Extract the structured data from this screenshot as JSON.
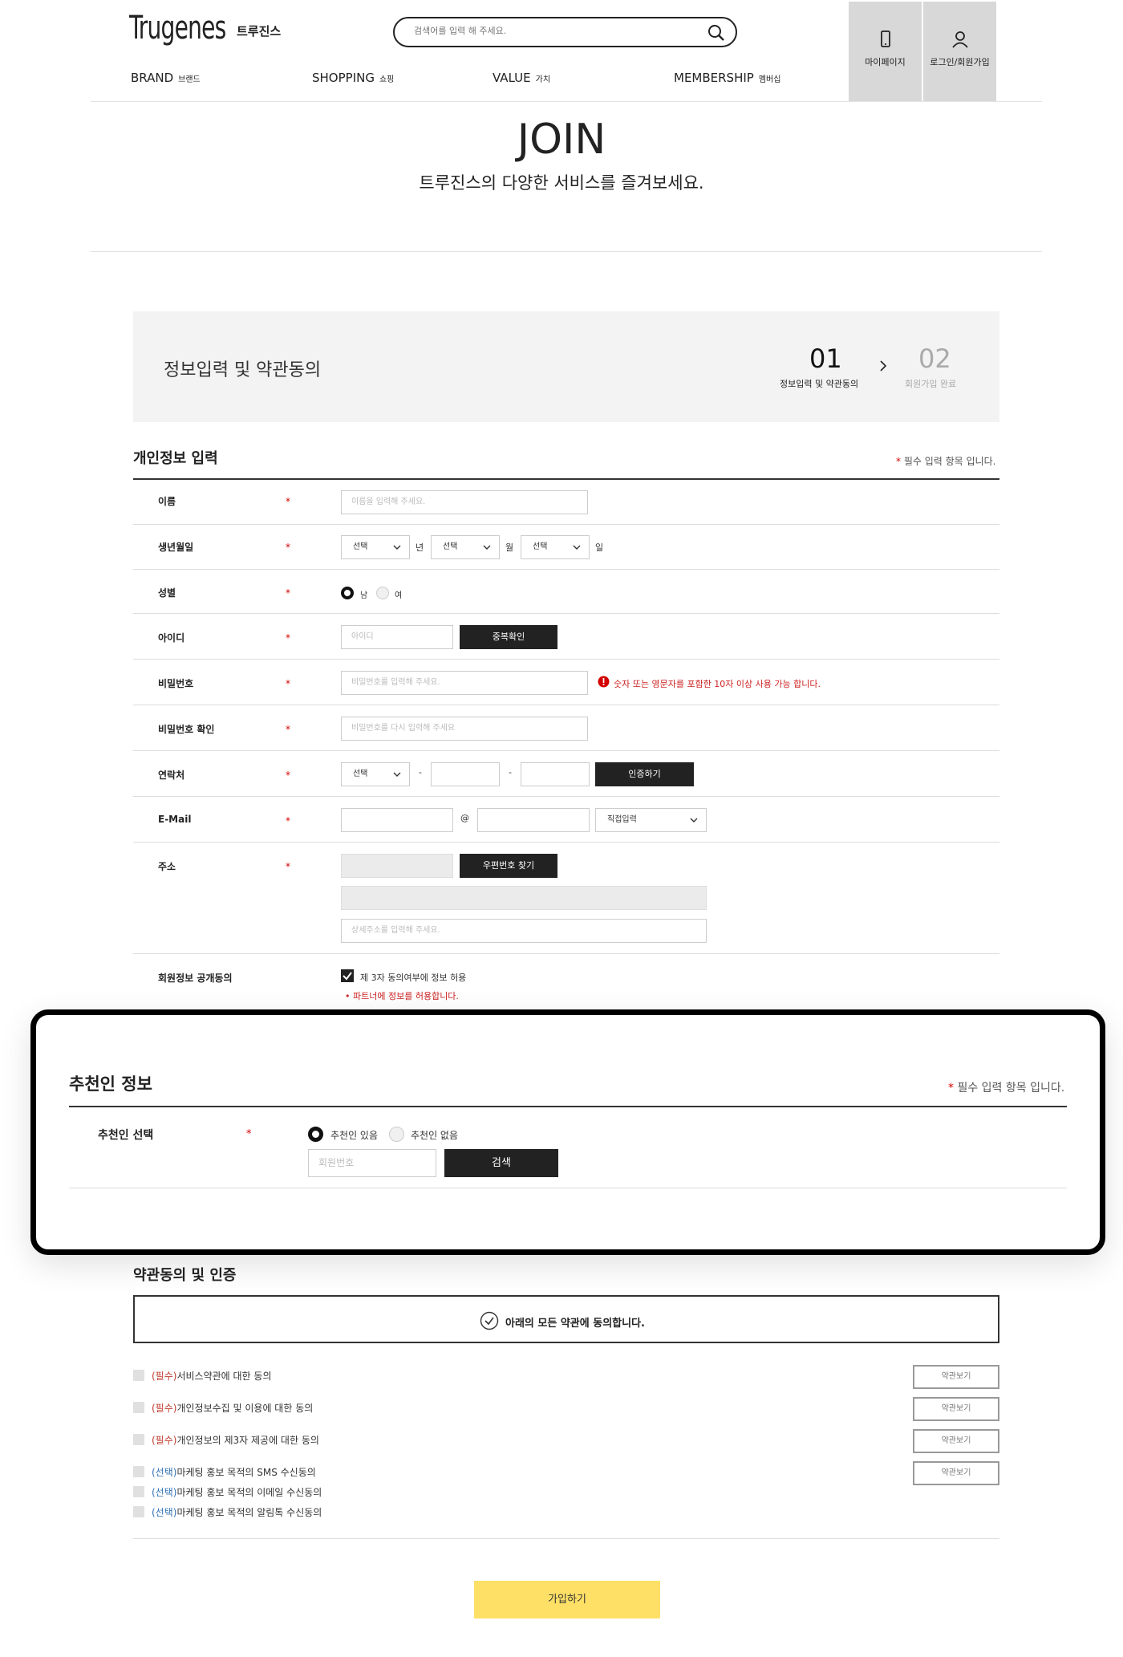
{
  "header": {
    "logo": "Trugenes",
    "logo_kr": "트루진스",
    "search_placeholder": "검색어를 입력 해 주세요.",
    "nav": [
      {
        "en": "BRAND",
        "kr": "브랜드"
      },
      {
        "en": "SHOPPING",
        "kr": "쇼핑"
      },
      {
        "en": "VALUE",
        "kr": "가치"
      },
      {
        "en": "MEMBERSHIP",
        "kr": "멤버십"
      }
    ],
    "mypage": "마이페이지",
    "login": "로그인/회원가입"
  },
  "hero": {
    "title": "JOIN",
    "subtitle": "트루진스의 다양한 서비스를 즐겨보세요."
  },
  "steps": {
    "title": "정보입력 및 약관동의",
    "step1_num": "01",
    "step1_label": "정보입력 및 약관동의",
    "step2_num": "02",
    "step2_label": "회원가입 완료"
  },
  "personal": {
    "title": "개인정보 입력",
    "required_note": "필수 입력 항목 입니다.",
    "star": "*",
    "name_label": "이름",
    "name_placeholder": "이름을 입력해 주세요.",
    "birth_label": "생년월일",
    "select": "선택",
    "year": "년",
    "month": "월",
    "day": "일",
    "gender_label": "성별",
    "male": "남",
    "female": "여",
    "id_label": "아이디",
    "id_placeholder": "아이디",
    "id_check": "중복확인",
    "pw_label": "비밀번호",
    "pw_placeholder": "비밀번호를 입력해 주세요.",
    "pw_warning": "숫자 또는 영문자를 포함한 10자 이상 사용 가능 합니다.",
    "pw2_label": "비밀번호 확인",
    "pw2_placeholder": "비밀번호를 다시 입력해 주세요",
    "phone_label": "연락처",
    "dash": "-",
    "verify": "인증하기",
    "email_label": "E-Mail",
    "at": "@",
    "direct_input": "직접입력",
    "address_label": "주소",
    "zip_button": "우편번호 찾기",
    "detail_placeholder": "상세주소를 입력해 주세요.",
    "disclose_label": "회원정보 공개동의",
    "disclose_text": "제 3자 동의여부에 정보 허용",
    "disclose_note": "파트너에 정보를 허용합니다."
  },
  "referral": {
    "title": "추천인 정보",
    "required_note": "필수 입력 항목 입니다.",
    "label": "추천인 선택",
    "yes": "추천인 있음",
    "no": "추천인 없음",
    "member_placeholder": "회원번호",
    "search": "검색"
  },
  "terms": {
    "title": "약관동의 및 인증",
    "agree_all": "아래의 모든 약관에 동의합니다.",
    "items": [
      {
        "tag": "(필수)",
        "text": "서비스약관에 대한 동의",
        "type": "req",
        "view": "약관보기"
      },
      {
        "tag": "(필수)",
        "text": "개인정보수집 및 이용에 대한 동의",
        "type": "req",
        "view": "약관보기"
      },
      {
        "tag": "(필수)",
        "text": "개인정보의 제3자 제공에 대한 동의",
        "type": "req",
        "view": "약관보기"
      },
      {
        "tag": "(선택)",
        "text": "마케팅 홍보 목적의 SMS 수신동의",
        "type": "opt",
        "view": "약관보기"
      },
      {
        "tag": "(선택)",
        "text": "마케팅 홍보 목적의 이메일 수신동의",
        "type": "opt",
        "view": ""
      },
      {
        "tag": "(선택)",
        "text": "마케팅 홍보 목적의 알림톡 수신동의",
        "type": "opt",
        "view": ""
      }
    ],
    "submit": "가입하기"
  },
  "colors": {
    "accent": "#ffe066",
    "dark": "#222222",
    "required": "#d40000",
    "warning": "#cc1f1f",
    "optional": "#2f6fb5"
  }
}
